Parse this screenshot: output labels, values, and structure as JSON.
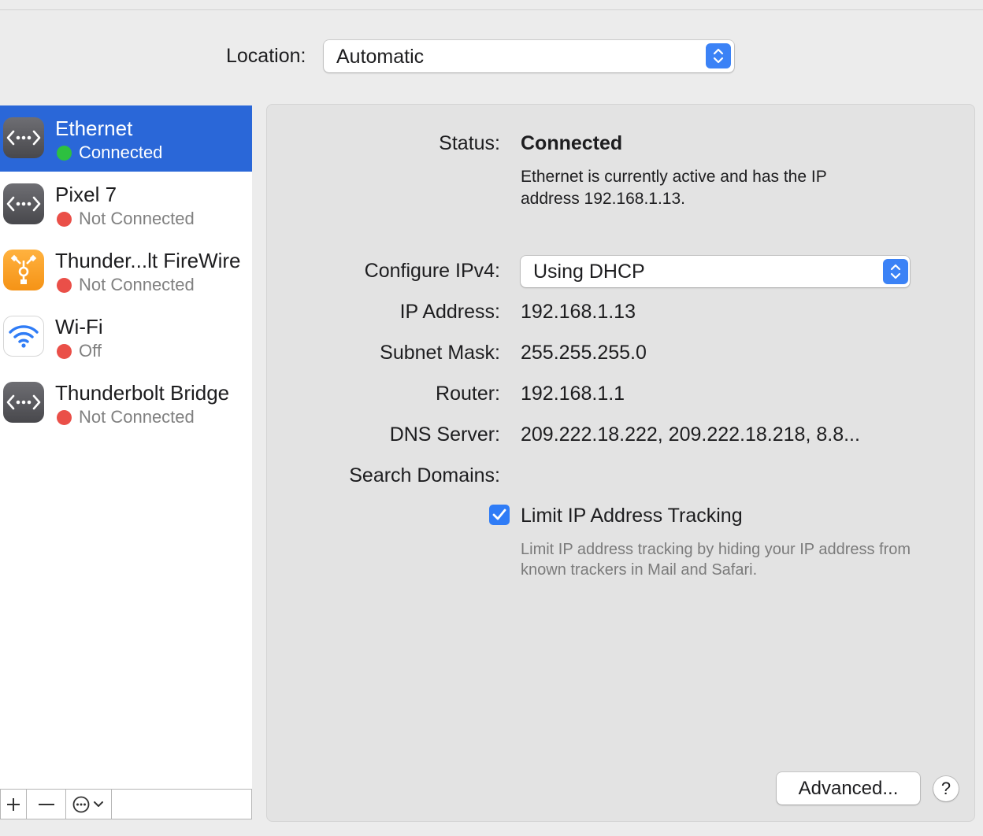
{
  "location": {
    "label": "Location:",
    "value": "Automatic"
  },
  "services": [
    {
      "name": "Ethernet",
      "status": "Connected",
      "status_color": "#2dc040",
      "icon": "ethernet-arrows-icon",
      "selected": true
    },
    {
      "name": "Pixel 7",
      "status": "Not Connected",
      "status_color": "#ea4f48",
      "icon": "ethernet-arrows-icon",
      "selected": false
    },
    {
      "name": "Thunder...lt FireWire",
      "status": "Not Connected",
      "status_color": "#ea4f48",
      "icon": "firewire-icon",
      "selected": false
    },
    {
      "name": "Wi-Fi",
      "status": "Off",
      "status_color": "#ea4f48",
      "icon": "wifi-icon",
      "selected": false
    },
    {
      "name": "Thunderbolt Bridge",
      "status": "Not Connected",
      "status_color": "#ea4f48",
      "icon": "ethernet-arrows-icon",
      "selected": false
    }
  ],
  "toolbar": {
    "add_icon": "plus-icon",
    "remove_icon": "minus-icon",
    "action_icon": "ellipsis-circle-icon"
  },
  "detail": {
    "status_label": "Status:",
    "status_value": "Connected",
    "status_description": "Ethernet is currently active and has the IP address 192.168.1.13.",
    "configure_label": "Configure IPv4:",
    "configure_value": "Using DHCP",
    "ip_label": "IP Address:",
    "ip_value": "192.168.1.13",
    "subnet_label": "Subnet Mask:",
    "subnet_value": "255.255.255.0",
    "router_label": "Router:",
    "router_value": "192.168.1.1",
    "dns_label": "DNS Server:",
    "dns_value": "209.222.18.222, 209.222.18.218, 8.8...",
    "search_label": "Search Domains:",
    "limit_label": "Limit IP Address Tracking",
    "limit_checked": true,
    "limit_description": "Limit IP address tracking by hiding your IP address from known trackers in Mail and Safari.",
    "advanced_label": "Advanced...",
    "help_label": "?"
  },
  "colors": {
    "accent": "#2a67d8",
    "connected": "#2dc040",
    "disconnected": "#ea4f48"
  }
}
